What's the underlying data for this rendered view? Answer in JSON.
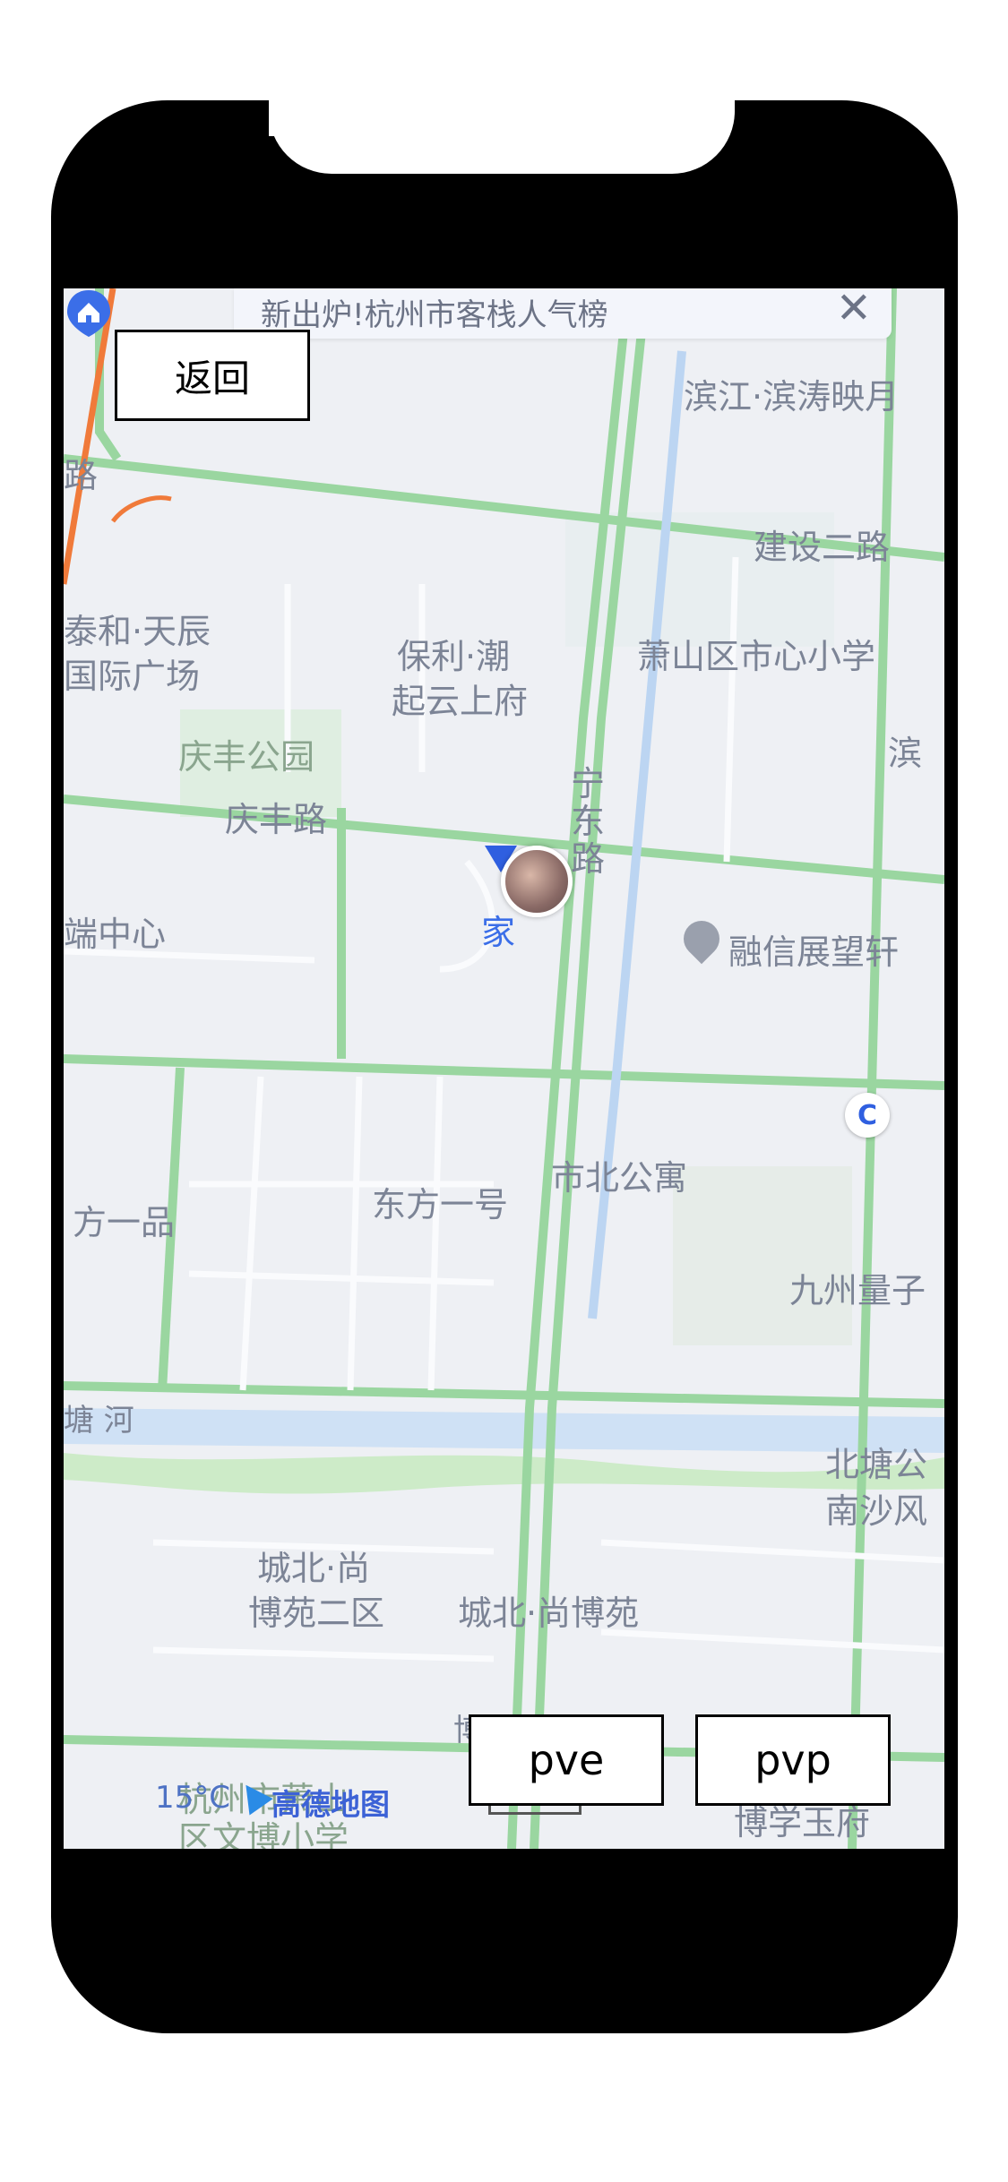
{
  "banner": {
    "text": "新出炉!杭州市客栈人气榜",
    "close_glyph": "✕"
  },
  "buttons": {
    "back": "返回",
    "pve": "pve",
    "pvp": "pvp"
  },
  "map": {
    "labels": {
      "binjiang": "滨江·滨涛映月",
      "jianshe": "建设二路",
      "road_left": "路",
      "taihe1": "泰和·天辰",
      "taihe2": "国际广场",
      "baoli1": "保利·潮",
      "baoli2": "起云上府",
      "school": "萧山区市心小学",
      "bin_edge": "滨",
      "qingfeng_park": "庆丰公园",
      "qingfeng_road": "庆丰路",
      "ningdong": "宁东路",
      "duan": "端中心",
      "home": "家",
      "rongxin": "融信展望轩",
      "dongfang_edge": "方一品",
      "dongfang": "东方一号",
      "shibei": "市北公寓",
      "jiuzhou": "九州量子",
      "tanghe": "塘 河",
      "beitang1": "北塘公",
      "beitang2": "南沙风",
      "chengbei1": "城北·尚",
      "chengbei2": "博苑二区",
      "chengbei3": "城北·尚博苑",
      "boxue_road": "博 学 路",
      "xiaoxue1": "杭州市萧山",
      "xiaoxue2": "区文博小学",
      "boxue_yufu": "博学玉府"
    }
  },
  "footer": {
    "weather": "15°C",
    "logo": "高德地图"
  }
}
